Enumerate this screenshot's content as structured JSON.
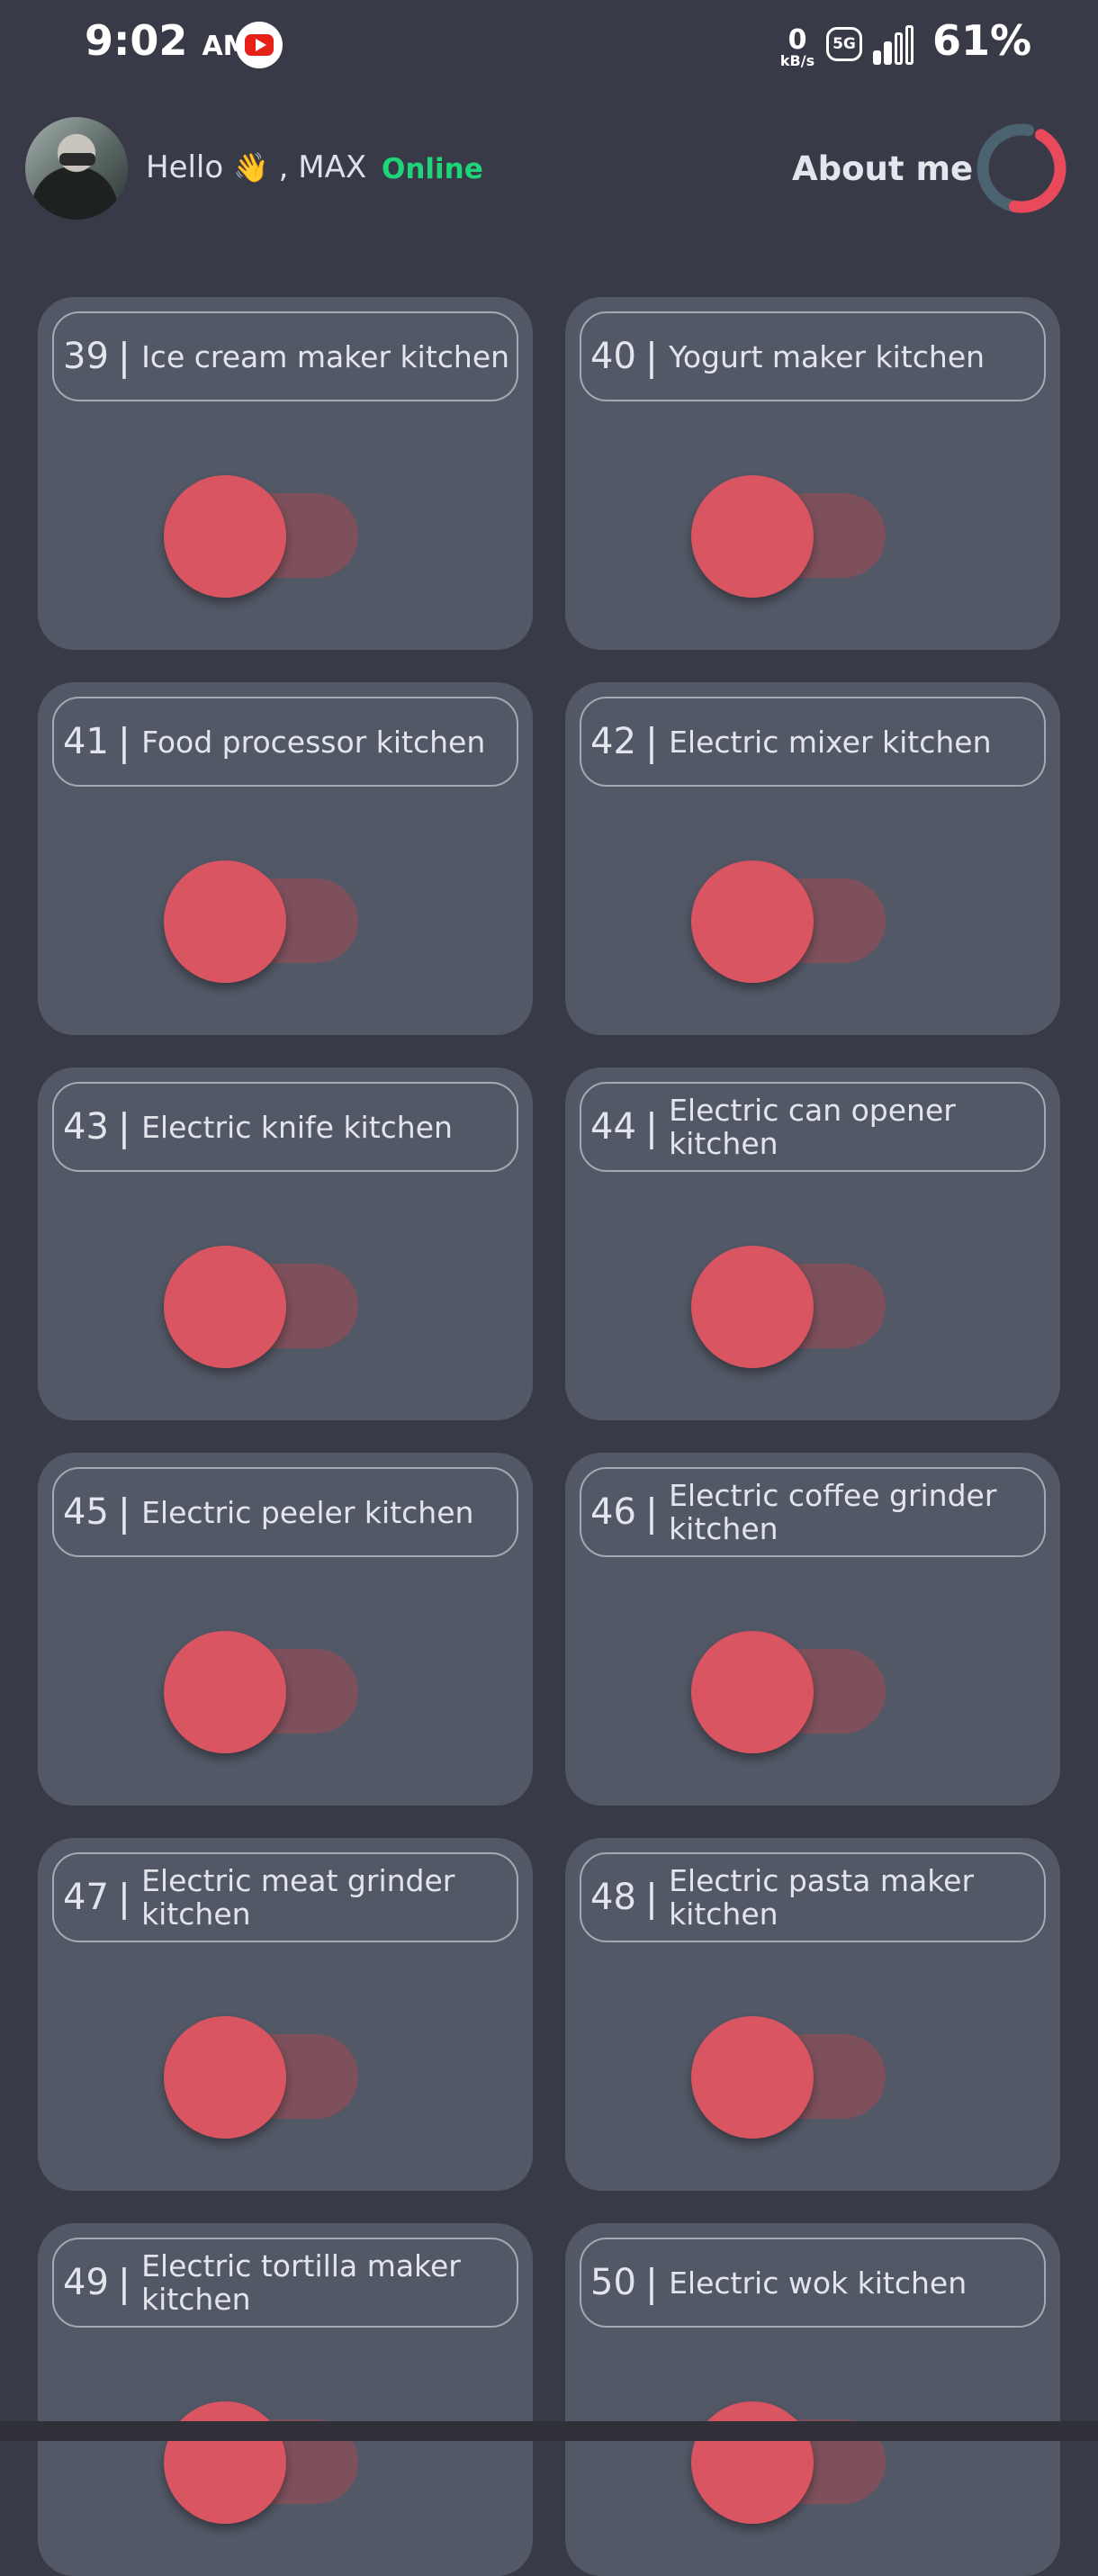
{
  "status": {
    "time": "9:02",
    "ampm": "AM",
    "net_speed": "0",
    "net_unit": "kB/s",
    "network": "5G",
    "battery": "61%"
  },
  "header": {
    "greeting": "Hello",
    "wave": "👋",
    "user": ", MAX",
    "online": "Online",
    "about": "About me"
  },
  "colors": {
    "background": "#393a47",
    "card": "#525866",
    "online": "#1ed67a",
    "toggle_knob_off": "#d95562",
    "toggle_track_off": "#7d505b",
    "spinner_red": "#e94a5b",
    "spinner_teal": "#4b6270"
  },
  "devices": [
    {
      "num": "39",
      "name": "Ice cream maker kitchen",
      "on": false
    },
    {
      "num": "40",
      "name": "Yogurt maker kitchen",
      "on": false
    },
    {
      "num": "41",
      "name": "Food processor kitchen",
      "on": false
    },
    {
      "num": "42",
      "name": "Electric mixer kitchen",
      "on": false
    },
    {
      "num": "43",
      "name": "Electric knife kitchen",
      "on": false
    },
    {
      "num": "44",
      "name": "Electric can opener kitchen",
      "on": false
    },
    {
      "num": "45",
      "name": "Electric peeler kitchen",
      "on": false
    },
    {
      "num": "46",
      "name": "Electric coffee grinder kitchen",
      "on": false
    },
    {
      "num": "47",
      "name": "Electric meat grinder kitchen",
      "on": false
    },
    {
      "num": "48",
      "name": "Electric pasta maker kitchen",
      "on": false
    },
    {
      "num": "49",
      "name": "Electric tortilla maker kitchen",
      "on": false
    },
    {
      "num": "50",
      "name": "Electric wok kitchen",
      "on": false
    }
  ]
}
